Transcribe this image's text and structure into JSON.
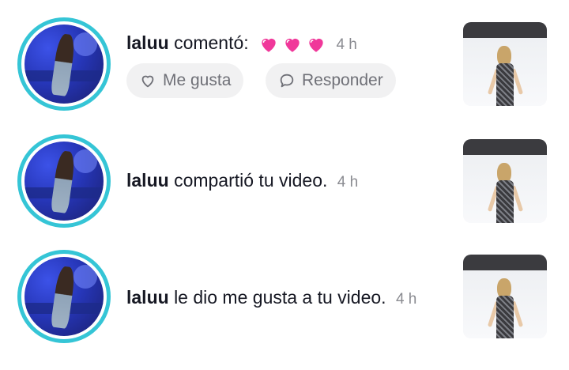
{
  "notifications": [
    {
      "username": "laluu",
      "action": "comentó:",
      "time": "4 h",
      "has_hearts": true,
      "buttons": {
        "like": "Me gusta",
        "reply": "Responder"
      }
    },
    {
      "username": "laluu",
      "action": "compartió tu video.",
      "time": "4 h"
    },
    {
      "username": "laluu",
      "action": "le dio me gusta a tu video.",
      "time": "4 h"
    }
  ],
  "colors": {
    "avatar_ring": "#35c5d6",
    "heart": "#f0389a",
    "time": "#8a8b91"
  },
  "icons": {
    "like": "heart-outline-icon",
    "reply": "speech-bubble-icon",
    "emoji": "pink-heart-emoji"
  }
}
